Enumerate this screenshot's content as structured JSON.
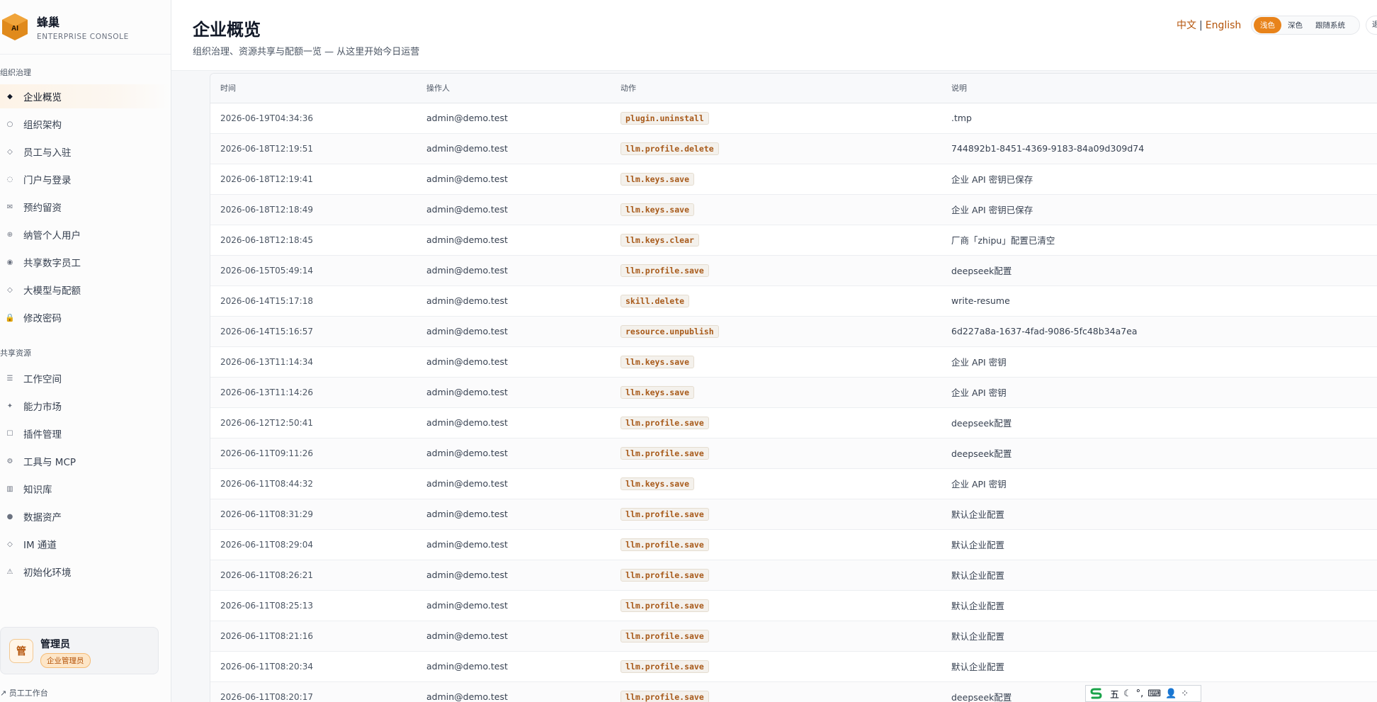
{
  "brand": {
    "logo_text": "AI",
    "title": "蜂巢",
    "subtitle": "ENTERPRISE CONSOLE"
  },
  "sidebar": {
    "sections": [
      {
        "label": "组织治理"
      },
      {
        "label": "共享资源"
      }
    ],
    "items": [
      {
        "label": "企业概览",
        "icon": "diamond-icon",
        "glyph": "◆"
      },
      {
        "label": "组织架构",
        "icon": "circle-icon",
        "glyph": "○"
      },
      {
        "label": "员工与入驻",
        "icon": "small-diamond-icon",
        "glyph": "◇"
      },
      {
        "label": "门户与登录",
        "icon": "ring-icon",
        "glyph": "◌"
      },
      {
        "label": "预约留资",
        "icon": "mail-icon",
        "glyph": "✉"
      },
      {
        "label": "纳管个人用户",
        "icon": "globe-icon",
        "glyph": "⊕"
      },
      {
        "label": "共享数字员工",
        "icon": "radio-icon",
        "glyph": "◉"
      },
      {
        "label": "大模型与配额",
        "icon": "diamond-outline-icon",
        "glyph": "◇"
      },
      {
        "label": "修改密码",
        "icon": "lock-icon",
        "glyph": "🔒"
      },
      {
        "label": "工作空间",
        "icon": "list-icon",
        "glyph": "☰"
      },
      {
        "label": "能力市场",
        "icon": "sparkle-icon",
        "glyph": "✦"
      },
      {
        "label": "插件管理",
        "icon": "square-icon",
        "glyph": "☐"
      },
      {
        "label": "工具与 MCP",
        "icon": "gear-icon",
        "glyph": "⚙"
      },
      {
        "label": "知识库",
        "icon": "book-icon",
        "glyph": "▥"
      },
      {
        "label": "数据资产",
        "icon": "dot-icon",
        "glyph": "●"
      },
      {
        "label": "IM 通道",
        "icon": "link-icon",
        "glyph": "◇"
      },
      {
        "label": "初始化环境",
        "icon": "warning-icon",
        "glyph": "⚠"
      }
    ]
  },
  "user": {
    "avatar": "管",
    "name": "管理员",
    "role": "企业管理员"
  },
  "workbench_link": "↗ 员工工作台",
  "header": {
    "title": "企业概览",
    "subtitle": "组织治理、资源共享与配额一览 — 从这里开始今日运营",
    "lang_zh": "中文",
    "lang_sep": "|",
    "lang_en": "English",
    "theme": {
      "light": "浅色",
      "dark": "深色",
      "system": "跟随系统"
    },
    "extra": "退"
  },
  "table": {
    "columns": [
      "时间",
      "操作人",
      "动作",
      "说明"
    ],
    "rows": [
      {
        "time": "2026-06-19T04:34:36",
        "actor": "admin@demo.test",
        "action": "plugin.uninstall",
        "desc": ".tmp"
      },
      {
        "time": "2026-06-18T12:19:51",
        "actor": "admin@demo.test",
        "action": "llm.profile.delete",
        "desc": "744892b1-8451-4369-9183-84a09d309d74"
      },
      {
        "time": "2026-06-18T12:19:41",
        "actor": "admin@demo.test",
        "action": "llm.keys.save",
        "desc": "企业 API 密钥已保存"
      },
      {
        "time": "2026-06-18T12:18:49",
        "actor": "admin@demo.test",
        "action": "llm.keys.save",
        "desc": "企业 API 密钥已保存"
      },
      {
        "time": "2026-06-18T12:18:45",
        "actor": "admin@demo.test",
        "action": "llm.keys.clear",
        "desc": "厂商「zhipu」配置已清空"
      },
      {
        "time": "2026-06-15T05:49:14",
        "actor": "admin@demo.test",
        "action": "llm.profile.save",
        "desc": "deepseek配置"
      },
      {
        "time": "2026-06-14T15:17:18",
        "actor": "admin@demo.test",
        "action": "skill.delete",
        "desc": "write-resume"
      },
      {
        "time": "2026-06-14T15:16:57",
        "actor": "admin@demo.test",
        "action": "resource.unpublish",
        "desc": "6d227a8a-1637-4fad-9086-5fc48b34a7ea"
      },
      {
        "time": "2026-06-13T11:14:34",
        "actor": "admin@demo.test",
        "action": "llm.keys.save",
        "desc": "企业 API 密钥"
      },
      {
        "time": "2026-06-13T11:14:26",
        "actor": "admin@demo.test",
        "action": "llm.keys.save",
        "desc": "企业 API 密钥"
      },
      {
        "time": "2026-06-12T12:50:41",
        "actor": "admin@demo.test",
        "action": "llm.profile.save",
        "desc": "deepseek配置"
      },
      {
        "time": "2026-06-11T09:11:26",
        "actor": "admin@demo.test",
        "action": "llm.profile.save",
        "desc": "deepseek配置"
      },
      {
        "time": "2026-06-11T08:44:32",
        "actor": "admin@demo.test",
        "action": "llm.keys.save",
        "desc": "企业 API 密钥"
      },
      {
        "time": "2026-06-11T08:31:29",
        "actor": "admin@demo.test",
        "action": "llm.profile.save",
        "desc": "默认企业配置"
      },
      {
        "time": "2026-06-11T08:29:04",
        "actor": "admin@demo.test",
        "action": "llm.profile.save",
        "desc": "默认企业配置"
      },
      {
        "time": "2026-06-11T08:26:21",
        "actor": "admin@demo.test",
        "action": "llm.profile.save",
        "desc": "默认企业配置"
      },
      {
        "time": "2026-06-11T08:25:13",
        "actor": "admin@demo.test",
        "action": "llm.profile.save",
        "desc": "默认企业配置"
      },
      {
        "time": "2026-06-11T08:21:16",
        "actor": "admin@demo.test",
        "action": "llm.profile.save",
        "desc": "默认企业配置"
      },
      {
        "time": "2026-06-11T08:20:34",
        "actor": "admin@demo.test",
        "action": "llm.profile.save",
        "desc": "默认企业配置"
      },
      {
        "time": "2026-06-11T08:20:17",
        "actor": "admin@demo.test",
        "action": "llm.profile.save",
        "desc": "deepseek配置"
      }
    ]
  },
  "ime": {
    "mode": "五",
    "moon": "☾",
    "punct": "°,",
    "keyboard": "⌨",
    "user": "👤",
    "apps": "⁘"
  },
  "colors": {
    "accent": "#e8831a",
    "accent_text": "#b45309",
    "action_text": "#a85a1a"
  }
}
